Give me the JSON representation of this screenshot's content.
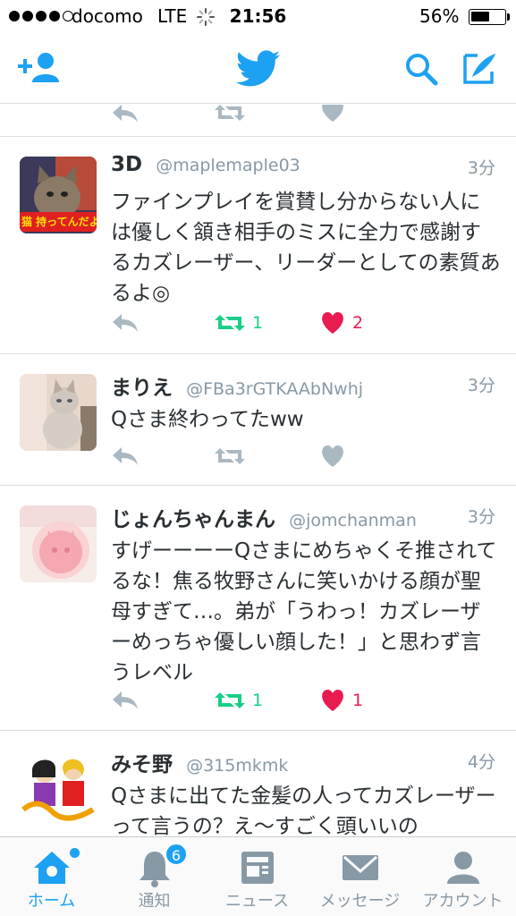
{
  "status_bar": {
    "carrier": "docomo",
    "network": "LTE",
    "time": "21:56",
    "battery_percent": "56%",
    "battery_level": 0.56
  },
  "nav": {
    "icons": [
      "add-user-icon",
      "twitter-bird-icon",
      "search-icon",
      "compose-icon"
    ]
  },
  "colors": {
    "brand": "#1da1f2",
    "retweet": "#19cf86",
    "like": "#e81c4f",
    "secondary_text": "#8899a6"
  },
  "tweets": [
    {
      "name": "3D",
      "handle": "@maplemaple03",
      "time": "3分",
      "text": "ファインプレイを賞賛し分からない人には優しく頷き相手のミスに全力で感謝するカズレーザー、リーダーとしての素質あるよ◎",
      "retweets": "1",
      "likes": "2",
      "retweeted": true,
      "liked": true,
      "avatar_text": "猫 持ってんだよ"
    },
    {
      "name": "まりえ",
      "handle": "@FBa3rGTKAAbNwhj",
      "time": "3分",
      "text": "Qさま終わってたww",
      "retweets": "",
      "likes": "",
      "retweeted": false,
      "liked": false,
      "avatar_text": ""
    },
    {
      "name": "じょんちゃんまん",
      "handle": "@jomchanman",
      "time": "3分",
      "text": "すげーーーーQさまにめちゃくそ推されてるな！焦る牧野さんに笑いかける顔が聖母すぎて…。弟が「うわっ！カズレーザーめっちゃ優しい顔した！」と思わず言うレベル",
      "retweets": "1",
      "likes": "1",
      "retweeted": true,
      "liked": true,
      "avatar_text": ""
    },
    {
      "name": "みそ野",
      "handle": "@315mkmk",
      "time": "4分",
      "text": "Qさまに出てた金髪の人ってカズレーザーって言うの？え〜すごく頭いいの",
      "retweets": "",
      "likes": "",
      "retweeted": false,
      "liked": false,
      "avatar_text": ""
    }
  ],
  "tab_bar": {
    "tabs": [
      {
        "label": "ホーム",
        "icon": "home-icon",
        "active": true
      },
      {
        "label": "通知",
        "icon": "bell-icon",
        "active": false,
        "badge": "6"
      },
      {
        "label": "ニュース",
        "icon": "news-icon",
        "active": false
      },
      {
        "label": "メッセージ",
        "icon": "envelope-icon",
        "active": false
      },
      {
        "label": "アカウント",
        "icon": "person-icon",
        "active": false
      }
    ]
  }
}
